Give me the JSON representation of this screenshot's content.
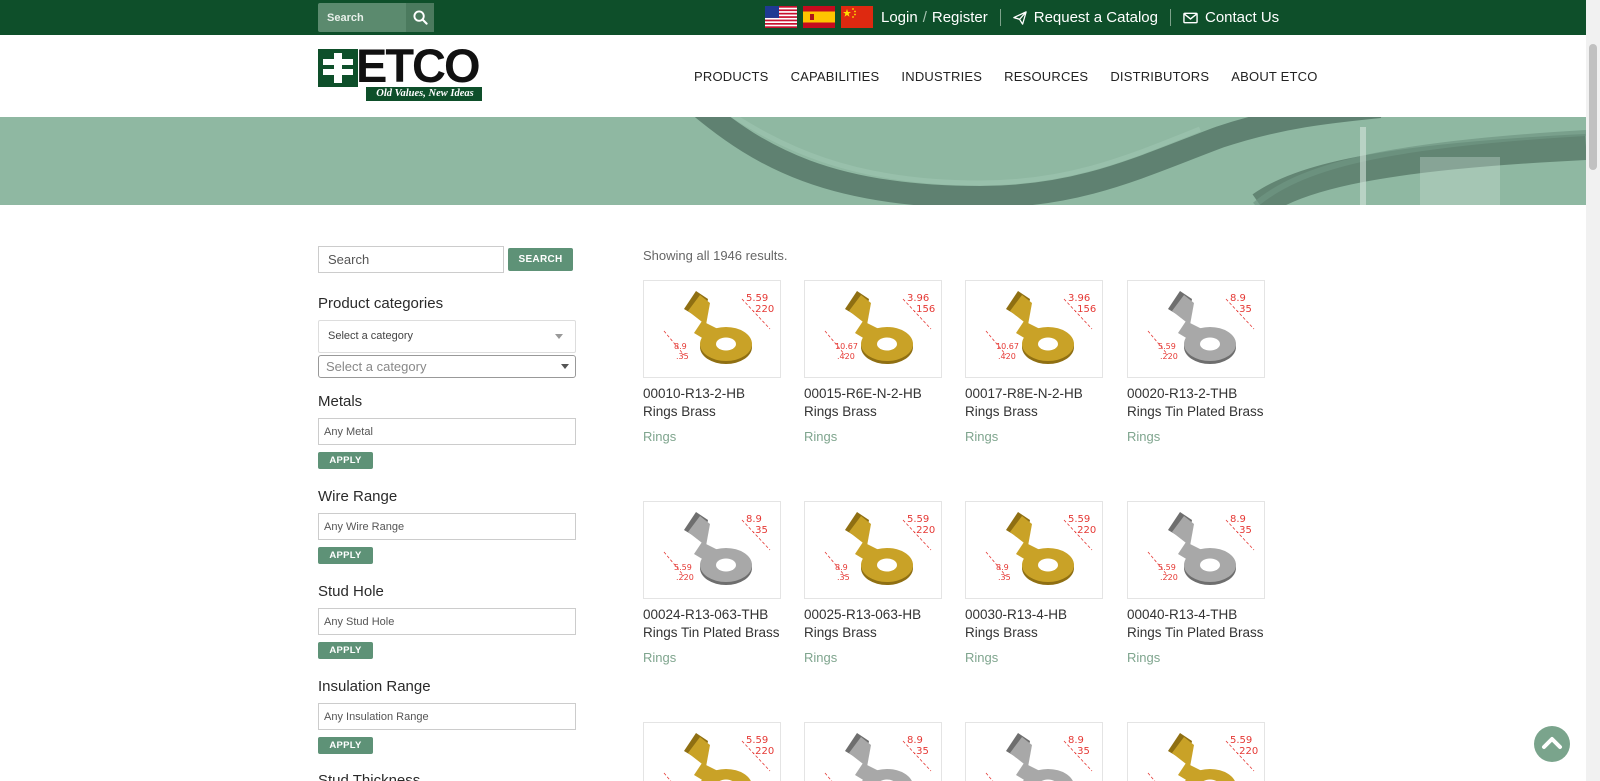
{
  "top_bar": {
    "search_placeholder": "Search",
    "login": "Login",
    "slash": "/",
    "register": "Register",
    "catalog": "Request a Catalog",
    "contact": "Contact Us"
  },
  "header": {
    "logo_text": "ETCO",
    "logo_tagline": "Old Values, New Ideas",
    "nav": [
      "PRODUCTS",
      "CAPABILITIES",
      "INDUSTRIES",
      "RESOURCES",
      "DISTRIBUTORS",
      "ABOUT ETCO"
    ]
  },
  "sidebar": {
    "search_placeholder": "Search",
    "search_button": "SEARCH",
    "categories_heading": "Product categories",
    "category_select": "Select a category",
    "category_select2": "Select a category",
    "filters": [
      {
        "heading": "Metals",
        "value": "Any Metal",
        "button": "APPLY"
      },
      {
        "heading": "Wire Range",
        "value": "Any Wire Range",
        "button": "APPLY"
      },
      {
        "heading": "Stud Hole",
        "value": "Any Stud Hole",
        "button": "APPLY"
      },
      {
        "heading": "Insulation Range",
        "value": "Any Insulation Range",
        "button": "APPLY"
      }
    ],
    "next_heading": "Stud Thickness"
  },
  "results_text": "Showing all 1946 results.",
  "products": [
    {
      "title": "00010-R13-2-HB Rings Brass",
      "category": "Rings",
      "finish": "brass",
      "dim1": "5.59",
      "dim2": ".220",
      "dim3": "8.9",
      "dim4": ".35"
    },
    {
      "title": "00015-R6E-N-2-HB Rings Brass",
      "category": "Rings",
      "finish": "brass",
      "dim1": "3.96",
      "dim2": ".156",
      "dim3": "10.67",
      "dim4": ".420"
    },
    {
      "title": "00017-R8E-N-2-HB Rings Brass",
      "category": "Rings",
      "finish": "brass",
      "dim1": "3.96",
      "dim2": ".156",
      "dim3": "10.67",
      "dim4": ".420"
    },
    {
      "title": "00020-R13-2-THB Rings Tin Plated Brass",
      "category": "Rings",
      "finish": "tin",
      "dim1": "8.9",
      "dim2": ".35",
      "dim3": "5.59",
      "dim4": ".220"
    },
    {
      "title": "00024-R13-063-THB Rings Tin Plated Brass",
      "category": "Rings",
      "finish": "tin",
      "dim1": "8.9",
      "dim2": ".35",
      "dim3": "5.59",
      "dim4": ".220"
    },
    {
      "title": "00025-R13-063-HB Rings Brass",
      "category": "Rings",
      "finish": "brass",
      "dim1": "5.59",
      "dim2": ".220",
      "dim3": "8.9",
      "dim4": ".35"
    },
    {
      "title": "00030-R13-4-HB Rings Brass",
      "category": "Rings",
      "finish": "brass",
      "dim1": "5.59",
      "dim2": ".220",
      "dim3": "8.9",
      "dim4": ".35"
    },
    {
      "title": "00040-R13-4-THB Rings Tin Plated Brass",
      "category": "Rings",
      "finish": "tin",
      "dim1": "8.9",
      "dim2": ".35",
      "dim3": "5.59",
      "dim4": ".220"
    },
    {
      "title": "",
      "category": "",
      "finish": "brass",
      "dim1": "5.59",
      "dim2": ".220",
      "dim3": "",
      "dim4": ""
    },
    {
      "title": "",
      "category": "",
      "finish": "tin",
      "dim1": "8.9",
      "dim2": ".35",
      "dim3": "",
      "dim4": ""
    },
    {
      "title": "",
      "category": "",
      "finish": "tin",
      "dim1": "8.9",
      "dim2": ".35",
      "dim3": "",
      "dim4": ""
    },
    {
      "title": "",
      "category": "",
      "finish": "brass",
      "dim1": "5.59",
      "dim2": ".220",
      "dim3": "",
      "dim4": ""
    }
  ],
  "colors": {
    "topbar": "#0e4f2a",
    "accent": "#5e9277",
    "brass": "#c9a227",
    "tin": "#a8a8a8",
    "dimension": "#e53935"
  },
  "icons": {
    "search": "magnifier-icon",
    "catalog": "paper-plane-icon",
    "contact": "envelope-icon",
    "back_to_top": "chevron-up-icon"
  }
}
